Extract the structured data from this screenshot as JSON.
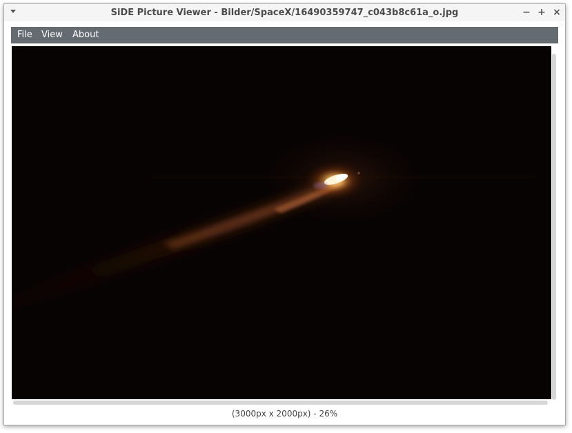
{
  "window": {
    "title": "SiDE Picture Viewer - Bilder/SpaceX/16490359747_c043b8c61a_o.jpg",
    "minimize_glyph": "−",
    "maximize_glyph": "+",
    "close_glyph": "×"
  },
  "menubar": {
    "items": [
      {
        "label": "File"
      },
      {
        "label": "View"
      },
      {
        "label": "About"
      }
    ]
  },
  "image": {
    "subject": "rocket launch streak at night",
    "background_color": "#070303"
  },
  "status": {
    "text": "(3000px x 2000px) - 26%"
  }
}
